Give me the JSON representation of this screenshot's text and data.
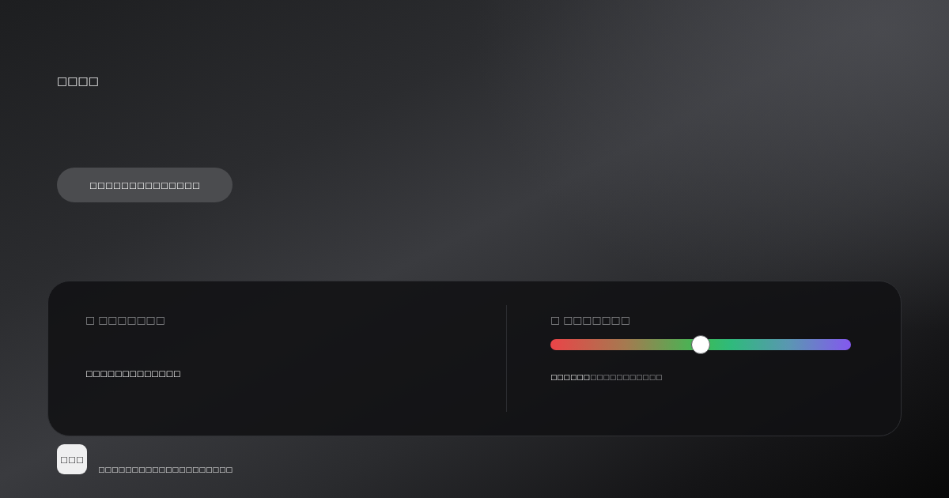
{
  "header": {
    "title": "□□□□"
  },
  "action_button": {
    "label": "□□□□□□□□□□□□□□"
  },
  "panel": {
    "left": {
      "label": "□ □□□□□□□",
      "value": "□□□□□□□□□□□□□"
    },
    "right": {
      "label": "□ □□□□□□□",
      "slider": {
        "level": 0.5
      },
      "reading": "□□□□□□",
      "caption": "□□□□□□□□□□□"
    }
  },
  "footer": {
    "badge": "□□□",
    "text": "□□□□□□□□□□□□□□□□□□□□"
  }
}
